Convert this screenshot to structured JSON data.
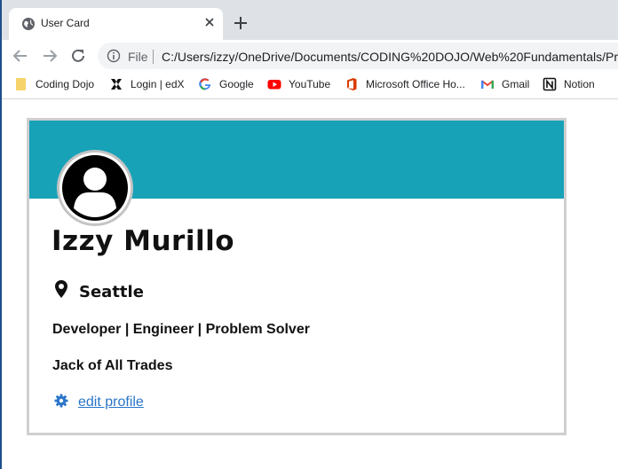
{
  "browser": {
    "tab": {
      "title": "User Card"
    },
    "address_bar": {
      "scheme_label": "File",
      "url": "C:/Users/izzy/OneDrive/Documents/CODING%20DOJO/Web%20Fundamentals/Prac"
    },
    "bookmarks": [
      {
        "label": "Coding Dojo",
        "icon": "folder-icon"
      },
      {
        "label": "Login | edX",
        "icon": "edx-icon"
      },
      {
        "label": "Google",
        "icon": "google-icon"
      },
      {
        "label": "YouTube",
        "icon": "youtube-icon"
      },
      {
        "label": "Microsoft Office Ho...",
        "icon": "office-icon"
      },
      {
        "label": "Gmail",
        "icon": "gmail-icon"
      },
      {
        "label": "Notion",
        "icon": "notion-icon"
      }
    ]
  },
  "card": {
    "name": "Izzy Murillo",
    "location": "Seattle",
    "titles": "Developer | Engineer | Problem Solver",
    "tagline": "Jack of All Trades",
    "edit_link": "edit profile",
    "colors": {
      "banner": "#17a2b8",
      "link": "#2a75c9"
    }
  }
}
